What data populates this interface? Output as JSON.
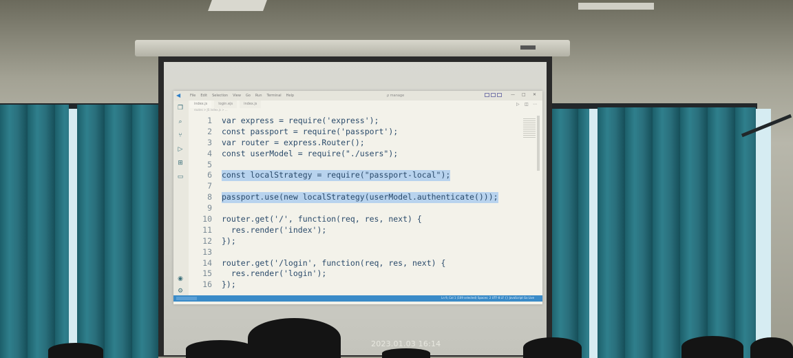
{
  "ide": {
    "menu": [
      "File",
      "Edit",
      "Selection",
      "View",
      "Go",
      "Run",
      "Terminal",
      "Help"
    ],
    "window_title": "ρ manage",
    "tabs": [
      "index.js",
      "login.ejs",
      "index.js"
    ],
    "breadcrumb": "routes > JS index.js > ...",
    "statusbar": "Ln 9, Col 1 (109 selected)   Spaces: 2   UTF-8   LF   {} JavaScript   Go Live",
    "code_lines": [
      {
        "n": "1",
        "text": "var express = require('express');",
        "selected": false
      },
      {
        "n": "2",
        "text": "const passport = require('passport');",
        "selected": false
      },
      {
        "n": "3",
        "text": "var router = express.Router();",
        "selected": false
      },
      {
        "n": "4",
        "text": "const userModel = require(\"./users\");",
        "selected": false
      },
      {
        "n": "5",
        "text": "",
        "selected": false
      },
      {
        "n": "6",
        "text": "const localStrategy = require(\"passport-local\");",
        "selected": true
      },
      {
        "n": "7",
        "text": "",
        "selected": true
      },
      {
        "n": "8",
        "text": "passport.use(new localStrategy(userModel.authenticate()));",
        "selected": true
      },
      {
        "n": "9",
        "text": "",
        "selected": false
      },
      {
        "n": "10",
        "text": "router.get('/', function(req, res, next) {",
        "selected": false
      },
      {
        "n": "11",
        "text": "  res.render('index');",
        "selected": false
      },
      {
        "n": "12",
        "text": "});",
        "selected": false
      },
      {
        "n": "13",
        "text": "",
        "selected": false
      },
      {
        "n": "14",
        "text": "router.get('/login', function(req, res, next) {",
        "selected": false
      },
      {
        "n": "15",
        "text": "  res.render('login');",
        "selected": false
      },
      {
        "n": "16",
        "text": "});",
        "selected": false
      }
    ]
  },
  "photo": {
    "timestamp": "2023.01.03 16:14"
  }
}
